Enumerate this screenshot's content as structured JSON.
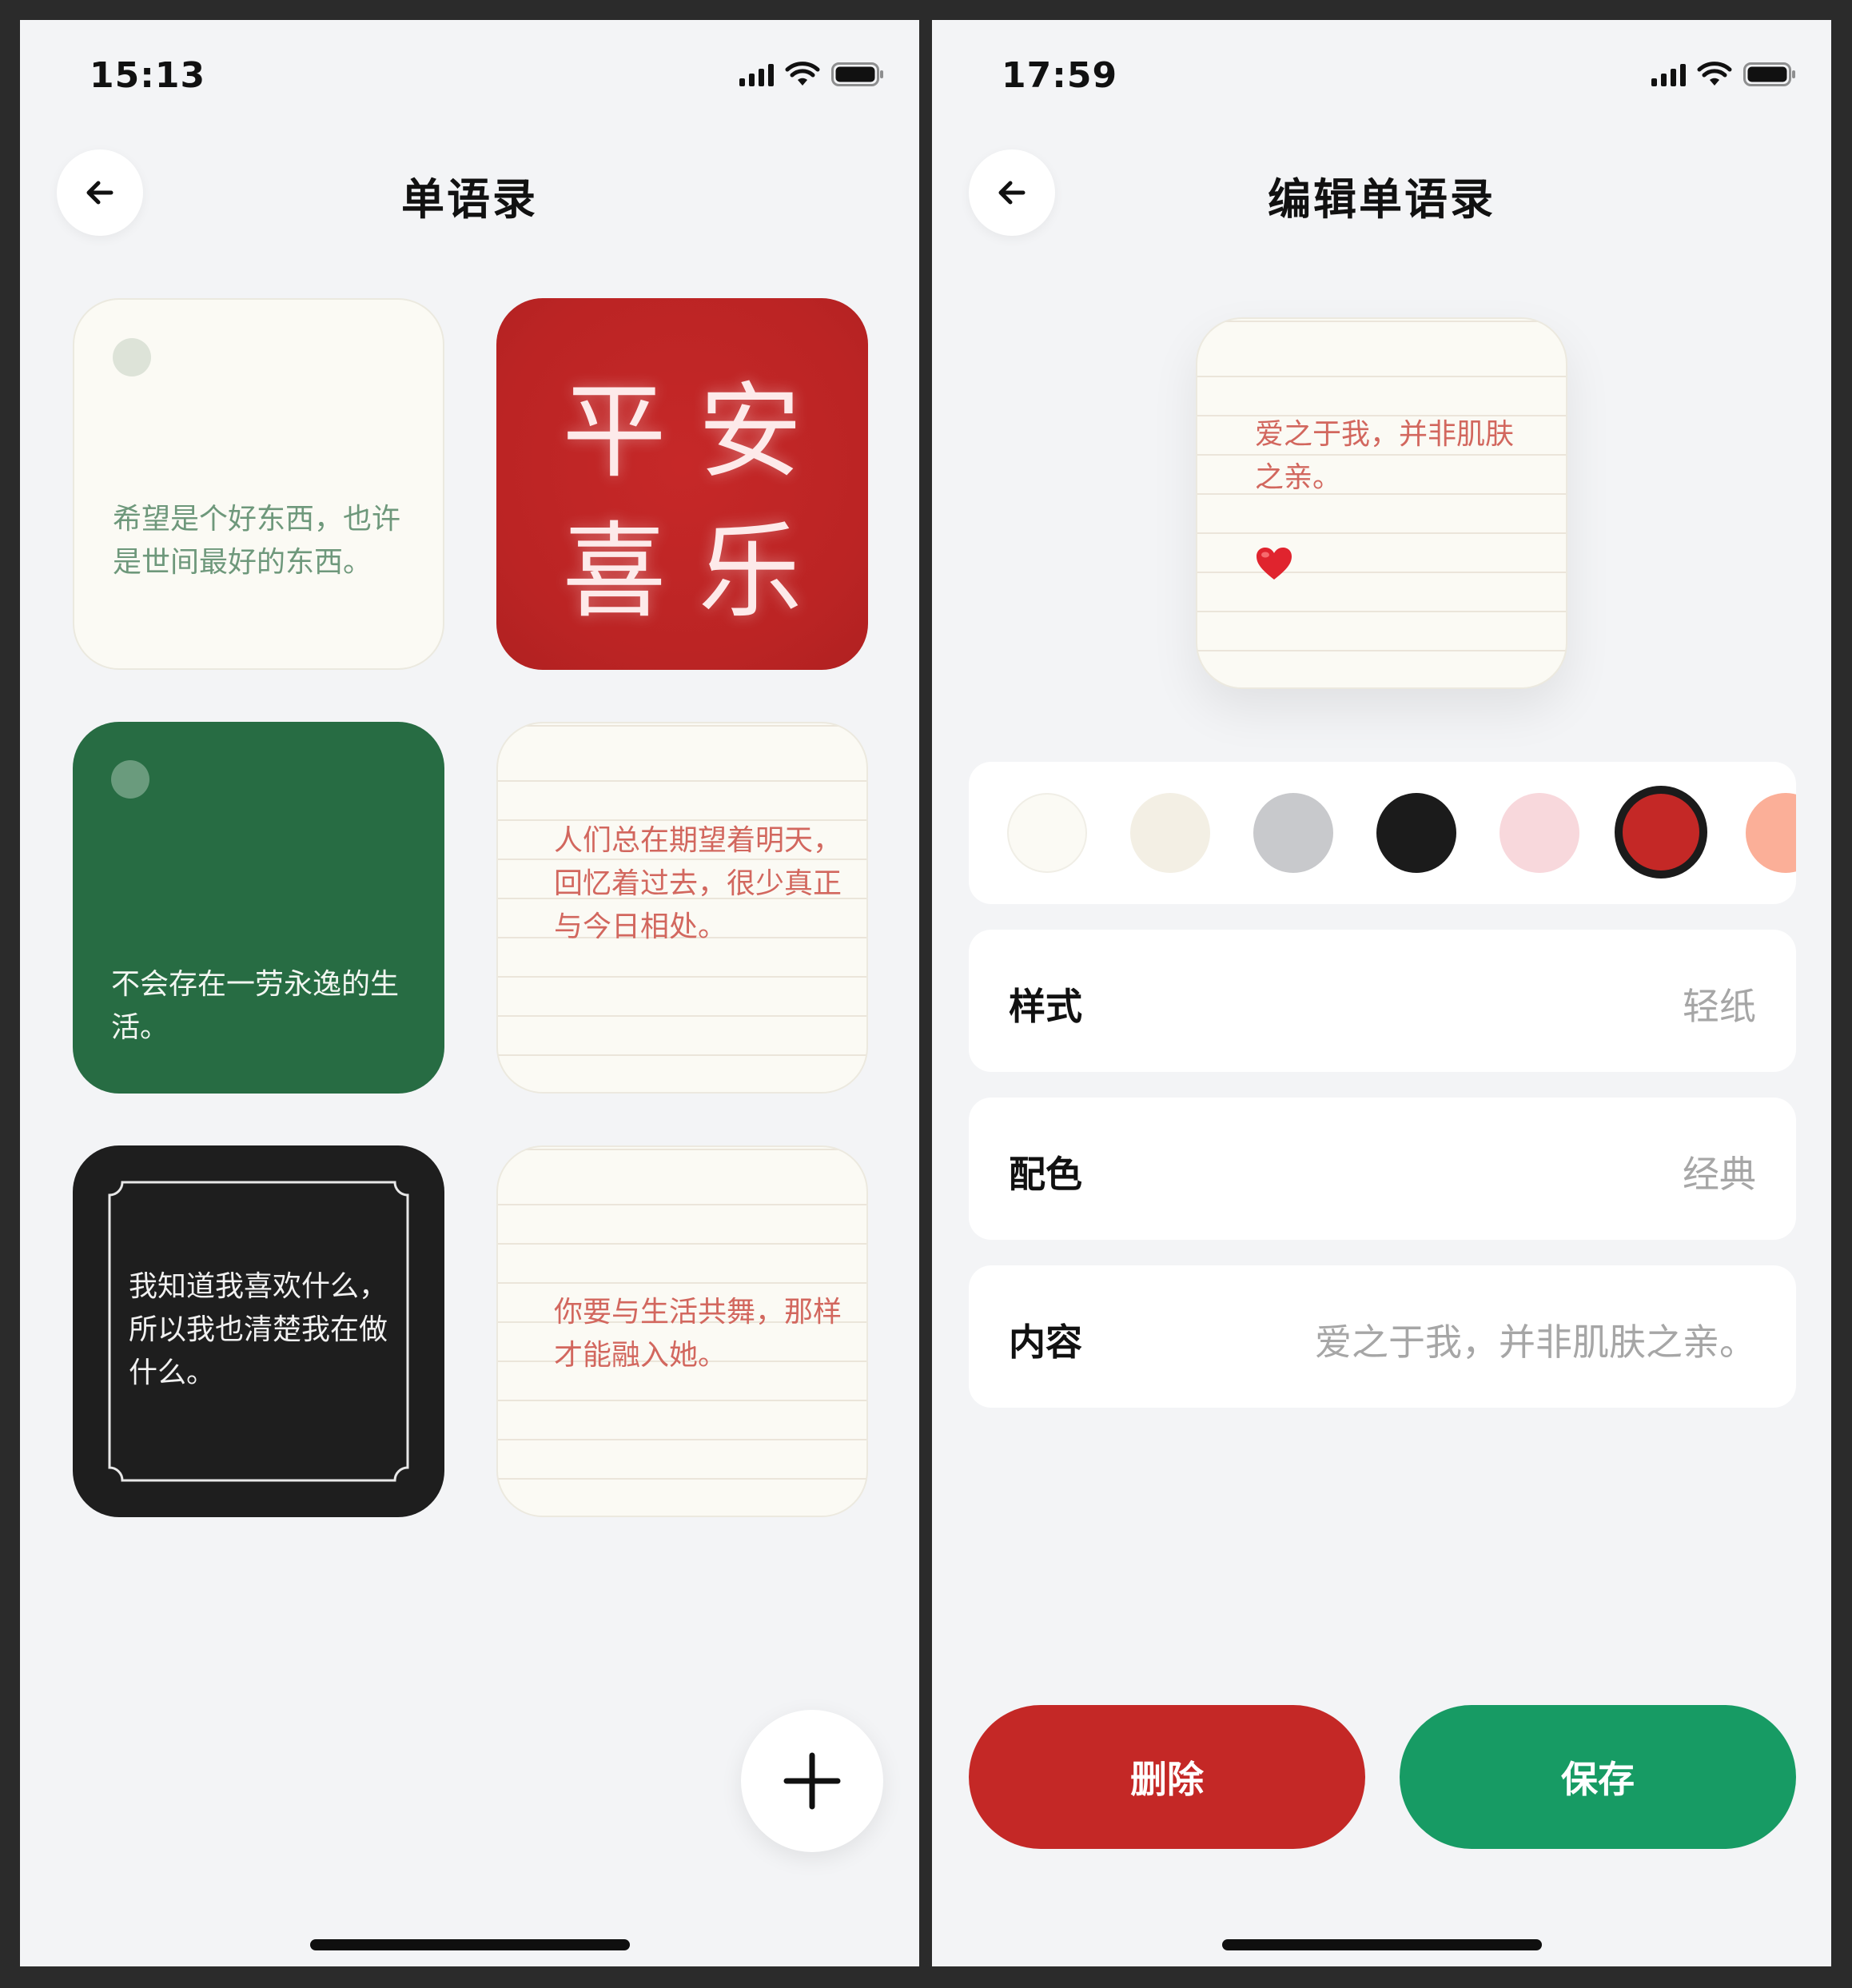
{
  "left": {
    "time": "15:13",
    "title": "单语录",
    "cards": [
      {
        "style": "plain-dot",
        "text": "希望是个好东西，也许是世间最好的东西。"
      },
      {
        "style": "red-big",
        "chars": [
          "平",
          "安",
          "喜",
          "乐"
        ]
      },
      {
        "style": "green-dot",
        "text": "不会存在一劳永逸的生活。"
      },
      {
        "style": "lined-paper",
        "text": "人们总在期望着明天，回忆着过去，很少真正与今日相处。"
      },
      {
        "style": "black-frame",
        "text": "我知道我喜欢什么，所以我也清楚我在做什么。"
      },
      {
        "style": "lined-paper",
        "text": "你要与生活共舞，那样才能融入她。"
      }
    ],
    "fab_icon": "plus-icon"
  },
  "right": {
    "time": "17:59",
    "title": "编辑单语录",
    "preview": {
      "text": "爱之于我，并非肌肤之亲。",
      "emoji": "heart-icon"
    },
    "palette": {
      "colors": [
        "#fbfaf4",
        "#f3efe4",
        "#c8c9cc",
        "#1b1b1b",
        "#f8d8dc",
        "#c42826",
        "#fbaf98"
      ],
      "selected_index": 5
    },
    "fields": [
      {
        "label": "样式",
        "value": "轻纸"
      },
      {
        "label": "配色",
        "value": "经典"
      },
      {
        "label": "内容",
        "value": "爱之于我，并非肌肤之亲。"
      }
    ],
    "delete_label": "删除",
    "save_label": "保存"
  },
  "colors": {
    "red": "#c42826",
    "green": "#179b64",
    "card_green": "#276c43",
    "paper": "#fbfaf4",
    "ink_red": "#d2675e"
  }
}
